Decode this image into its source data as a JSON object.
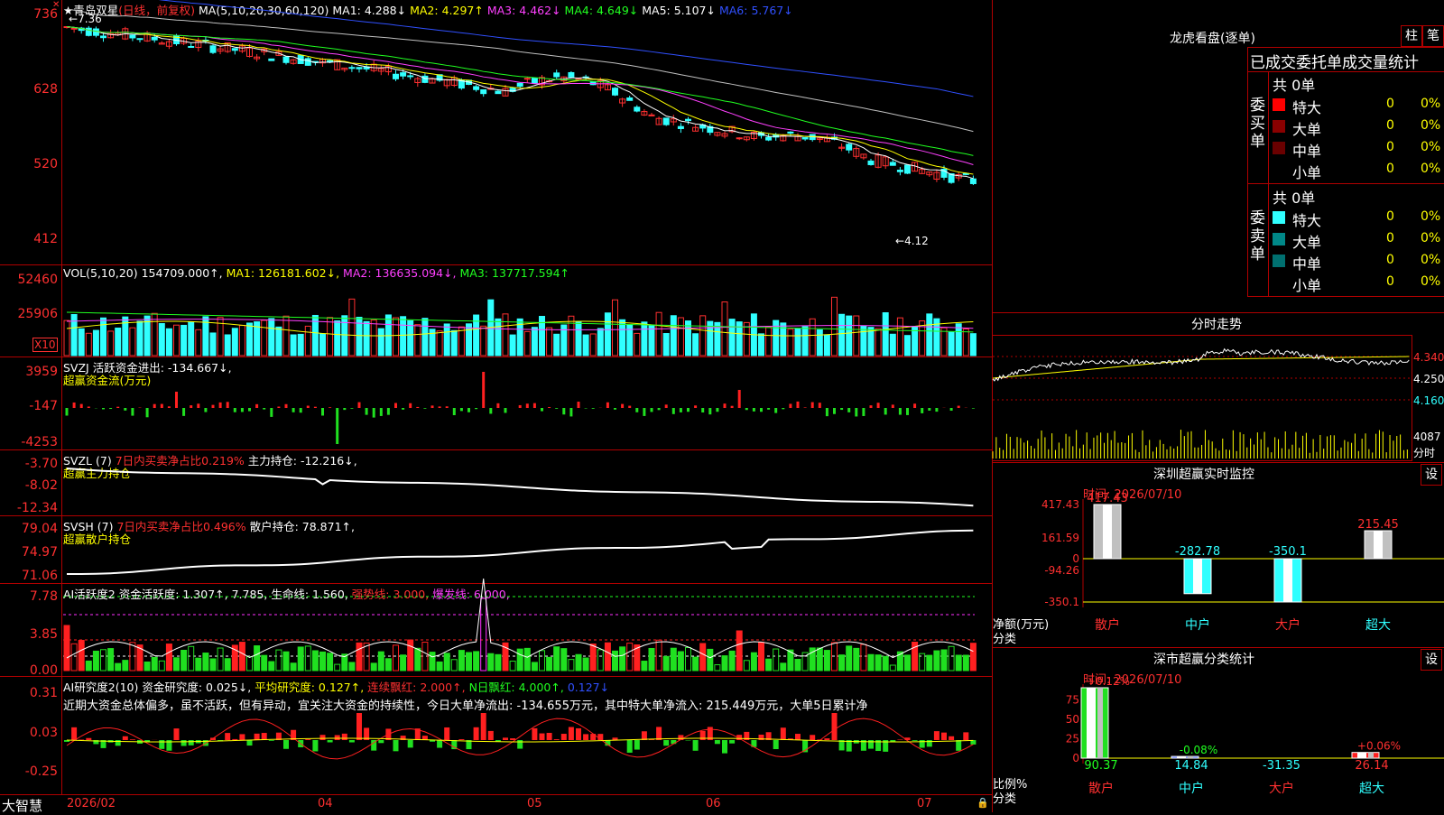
{
  "kline": {
    "title_icon": "star-icon",
    "stock_name": "青岛双星",
    "period": "(日线，前复权)",
    "ma_params": "MA(5,10,20,30,60,120)",
    "ma1": "MA1: 4.288↓",
    "ma2": "MA2: 4.297↑",
    "ma3": "MA3: 4.462↓",
    "ma4": "MA4: 4.649↓",
    "ma5": "MA5: 5.107↓",
    "ma6": "MA6: 5.767↓",
    "y_axis": [
      "736",
      "628",
      "520",
      "412"
    ],
    "high_mark": "7.36",
    "low_mark": "4.12"
  },
  "vol": {
    "label": "VOL(5,10,20)",
    "value": "154709.000↑,",
    "ma1": "MA1: 126181.602↓,",
    "ma2": "MA2: 136635.094↓,",
    "ma3": "MA3: 137717.594↑",
    "y_axis": [
      "52460",
      "25906"
    ],
    "unit": "X10"
  },
  "svzj": {
    "label": "SVZJ",
    "text": "活跃资金进出: -134.667↓,",
    "subtitle": "超赢资金流(万元)",
    "y_axis": [
      "3959",
      "-147",
      "-4253"
    ]
  },
  "svzl": {
    "label": "SVZL (7)",
    "ratio": "7日内买卖净占比0.219%",
    "holding": "主力持仓: -12.216↓,",
    "subtitle": "超赢主力持仓",
    "y_axis": [
      "-3.70",
      "-8.02",
      "-12.34"
    ]
  },
  "svsh": {
    "label": "SVSH (7)",
    "ratio": "7日内买卖净占比0.496%",
    "holding": "散户持仓: 78.871↑,",
    "subtitle": "超赢散户持仓",
    "y_axis": [
      "79.04",
      "74.97",
      "71.06"
    ]
  },
  "ai_active": {
    "label": "AI活跃度2",
    "activity": "资金活跃度: 1.307↑,",
    "val2": "7.785,",
    "life": "生命线: 1.560,",
    "strong": "强势线: 3.000,",
    "burst": "爆发线: 6.000,",
    "y_axis": [
      "7.78",
      "3.85",
      "0.00"
    ]
  },
  "ai_research": {
    "label": "AI研究度2(10)",
    "research": "资金研究度: 0.025↓,",
    "avg": "平均研究度: 0.127↑,",
    "consec": "连续飘红: 2.000↑,",
    "nday": "N日飘红: 4.000↑,",
    "last": "0.127↓",
    "note": "近期大资金总体偏多，虽不活跃，但有异动，宜关注大资金的持续性，今日大单净流出: -134.655万元，其中特大单净流入: 215.449万元，大单5日累计净",
    "y_axis": [
      "0.31",
      "0.03",
      "-0.25"
    ]
  },
  "bottom": {
    "app_name": "大智慧",
    "dates": [
      "2026/02",
      "04",
      "05",
      "06",
      "07"
    ],
    "lock_icon": "lock-icon"
  },
  "lhb": {
    "title": "龙虎看盘(逐单)",
    "btn_bar": "柱",
    "btn_pen": "笔",
    "tab": "已成交委托单成交量统计",
    "buy_label": "委买单",
    "sell_label": "委卖单",
    "buy_total": "共 0单",
    "sell_total": "共 0单",
    "rows": [
      {
        "name": "特大",
        "count": "0",
        "pct": "0%"
      },
      {
        "name": "大单",
        "count": "0",
        "pct": "0%"
      },
      {
        "name": "中单",
        "count": "0",
        "pct": "0%"
      },
      {
        "name": "小单",
        "count": "0",
        "pct": "0%"
      }
    ],
    "buy_colors": [
      "#ff0000",
      "#8a0000",
      "#6a0000",
      "#000000"
    ],
    "sell_colors": [
      "#30ffff",
      "#008888",
      "#007070",
      "#000000"
    ]
  },
  "intraday": {
    "title": "分时走势",
    "prices": [
      "4.340",
      "4.250",
      "4.160"
    ],
    "vol_max": "4087",
    "vol_unit": "分时"
  },
  "sz_monitor": {
    "title": "深圳超赢实时监控",
    "btn": "设",
    "time": "时间: 2026/07/10",
    "y_axis": [
      "417.43",
      "161.59",
      "0",
      "-94.26",
      "-350.1"
    ],
    "y_title": "净额(万元)",
    "x_title": "分类",
    "categories": [
      "散户",
      "中户",
      "大户",
      "超大"
    ],
    "values": [
      "417.43",
      "-282.78",
      "-350.1",
      "215.45"
    ]
  },
  "sz_stats": {
    "title": "深市超赢分类统计",
    "btn": "设",
    "time": "时间: 2026/07/10",
    "y_axis": [
      "75",
      "50",
      "25",
      "0"
    ],
    "y_title": "比例%",
    "x_title": "分类",
    "categories": [
      "散户",
      "中户",
      "大户",
      "超大"
    ],
    "top_labels": [
      "+0.12%",
      "-0.08%",
      "",
      "+0.06%"
    ],
    "values": [
      "90.37",
      "14.84",
      "-31.35",
      "26.14"
    ]
  },
  "colors": {
    "up": "#ff3030",
    "down": "#30ffff",
    "ma1": "#ffffff",
    "ma2": "#ffff00",
    "ma3": "#ff40ff",
    "ma4": "#20ff20",
    "ma5": "#c0c0c0",
    "ma6": "#3050ff",
    "border": "#b00000"
  }
}
